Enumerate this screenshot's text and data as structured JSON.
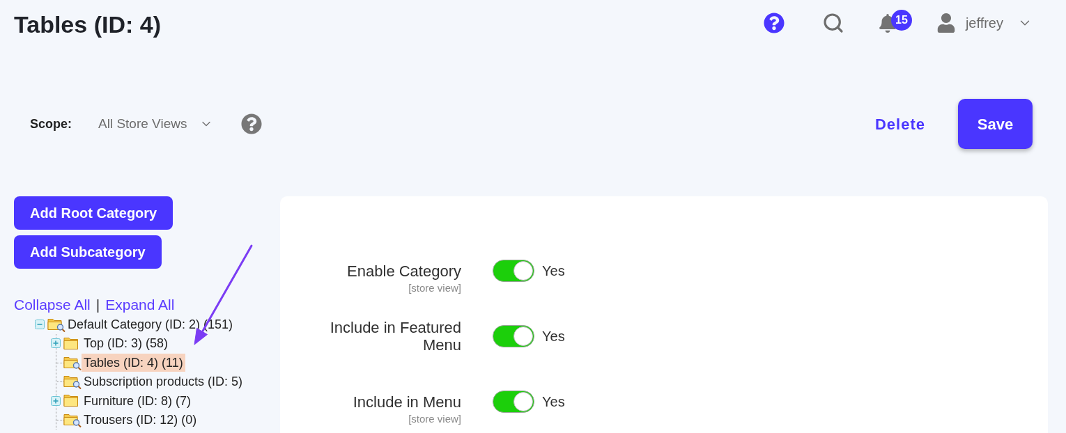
{
  "page": {
    "title": "Tables (ID: 4)"
  },
  "header": {
    "notification_count": "15",
    "user_name": "jeffrey"
  },
  "scope": {
    "label": "Scope:",
    "value": "All Store Views"
  },
  "actions": [
    {
      "kind": "link",
      "label": "Delete"
    },
    {
      "kind": "primary",
      "label": "Save"
    }
  ],
  "sidebar": {
    "buttons": [
      "Add Root Category",
      "Add Subcategory"
    ],
    "tree_controls": {
      "collapse": "Collapse All",
      "separator": "|",
      "expand": "Expand All"
    },
    "tree": [
      {
        "label": "Default Category (ID: 2) (151)",
        "anchor": true,
        "selected": false,
        "expanded": true,
        "children": [
          {
            "label": "Top (ID: 3) (58)",
            "anchor": false,
            "selected": false,
            "expanded": false
          },
          {
            "label": "Tables (ID: 4) (11)",
            "anchor": true,
            "selected": true
          },
          {
            "label": "Subscription products (ID: 5)",
            "anchor": true,
            "selected": false
          },
          {
            "label": "Furniture (ID: 8) (7)",
            "anchor": false,
            "selected": false,
            "expanded": false
          },
          {
            "label": "Trousers (ID: 12) (0)",
            "anchor": true,
            "selected": false
          }
        ]
      }
    ]
  },
  "form": {
    "fields": [
      {
        "label": "Enable Category",
        "scope": "[store view]",
        "on": true,
        "value": "Yes"
      },
      {
        "label": "Include in Featured Menu",
        "on": true,
        "value": "Yes"
      },
      {
        "label": "Include in Menu",
        "scope": "[store view]",
        "on": true,
        "value": "Yes"
      }
    ]
  }
}
